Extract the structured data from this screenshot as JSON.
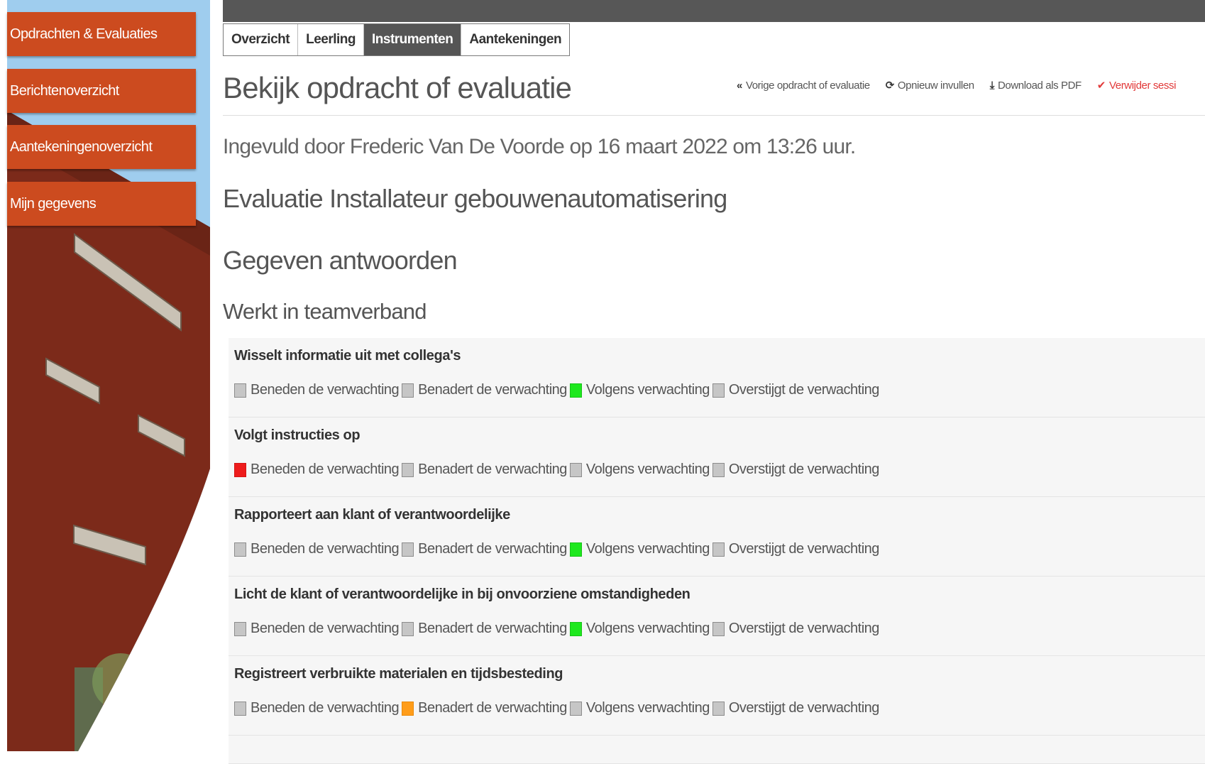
{
  "sidebar": {
    "items": [
      {
        "label": "Opdrachten & Evaluaties"
      },
      {
        "label": "Berichtenoverzicht"
      },
      {
        "label": "Aantekeningenoverzicht"
      },
      {
        "label": "Mijn gegevens"
      }
    ],
    "accent_color": "#cc4b1f"
  },
  "tabs": [
    {
      "label": "Overzicht",
      "active": false
    },
    {
      "label": "Leerling",
      "active": false
    },
    {
      "label": "Instrumenten",
      "active": true
    },
    {
      "label": "Aantekeningen",
      "active": false
    }
  ],
  "page": {
    "title": "Bekijk opdracht of evaluatie",
    "meta": "Ingevuld door Frederic Van De Voorde op 16 maart 2022 om 13:26 uur.",
    "evaluation_title": "Evaluatie Installateur gebouwenautomatisering",
    "answers_title": "Gegeven antwoorden",
    "section_title": "Werkt in teamverband"
  },
  "actions": [
    {
      "label": "Vorige opdracht of evaluatie",
      "icon": "double-chevron-left-icon"
    },
    {
      "label": "Opnieuw invullen",
      "icon": "refresh-icon"
    },
    {
      "label": "Download als PDF",
      "icon": "download-icon"
    },
    {
      "label": "Verwijder sessi",
      "icon": "checkmark-icon",
      "color": "#e23a3a"
    }
  ],
  "scale": [
    "Beneden de verwachting",
    "Benadert de verwachting",
    "Volgens verwachting",
    "Overstijgt de verwachting"
  ],
  "criteria": [
    {
      "title": "Wisselt informatie uit met collega's",
      "selected_index": 2,
      "selected_color": "#1ee81e"
    },
    {
      "title": "Volgt instructies op",
      "selected_index": 0,
      "selected_color": "#ee1c1c"
    },
    {
      "title": "Rapporteert aan klant of verantwoordelijke",
      "selected_index": 2,
      "selected_color": "#1ee81e"
    },
    {
      "title": "Licht de klant of verantwoordelijke in bij onvoorziene omstandigheden",
      "selected_index": 2,
      "selected_color": "#1ee81e"
    },
    {
      "title": "Registreert verbruikte materialen en tijdsbesteding",
      "selected_index": 1,
      "selected_color": "#ff9d1a"
    }
  ]
}
